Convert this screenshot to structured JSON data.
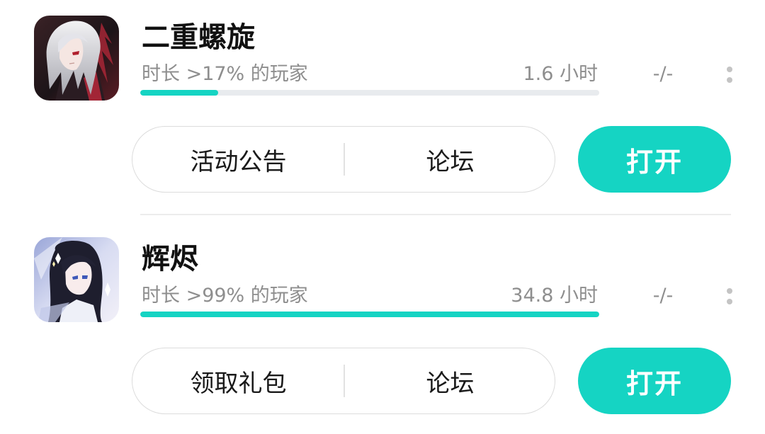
{
  "colors": {
    "accent": "#15d4c3",
    "muted_text": "#8e8e8e",
    "track": "#e8ebee"
  },
  "games": [
    {
      "title": "二重螺旋",
      "play_stat": "时长 >17% 的玩家",
      "play_hours": "1.6 小时",
      "score": "-/-",
      "progress": 0.17,
      "actions": [
        "活动公告",
        "论坛"
      ],
      "open_label": "打开",
      "icon": "game-icon-silver-hair-character"
    },
    {
      "title": "辉烬",
      "play_stat": "时长 >99% 的玩家",
      "play_hours": "34.8 小时",
      "score": "-/-",
      "progress": 1.0,
      "actions": [
        "领取礼包",
        "论坛"
      ],
      "open_label": "打开",
      "icon": "game-icon-dark-hair-character"
    }
  ]
}
